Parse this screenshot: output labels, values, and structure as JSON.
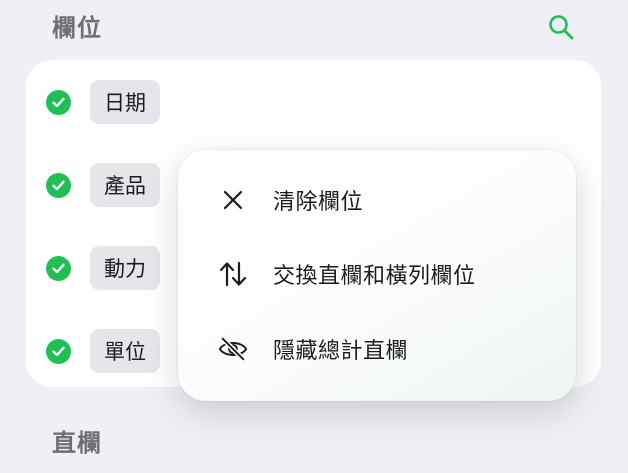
{
  "sections": {
    "fields_title": "欄位",
    "columns_title": "直欄"
  },
  "fields": [
    {
      "label": "日期",
      "checked": true
    },
    {
      "label": "產品",
      "checked": true
    },
    {
      "label": "動力",
      "checked": true
    },
    {
      "label": "單位",
      "checked": true
    }
  ],
  "menu": {
    "items": [
      {
        "label": "清除欄位",
        "icon": "close-icon"
      },
      {
        "label": "交換直欄和橫列欄位",
        "icon": "swap-arrows-icon"
      },
      {
        "label": "隱藏總計直欄",
        "icon": "eye-slash-icon"
      }
    ]
  },
  "colors": {
    "accent": "#1fbf54",
    "background": "#f0eff5",
    "chip": "#e6e6ea"
  }
}
